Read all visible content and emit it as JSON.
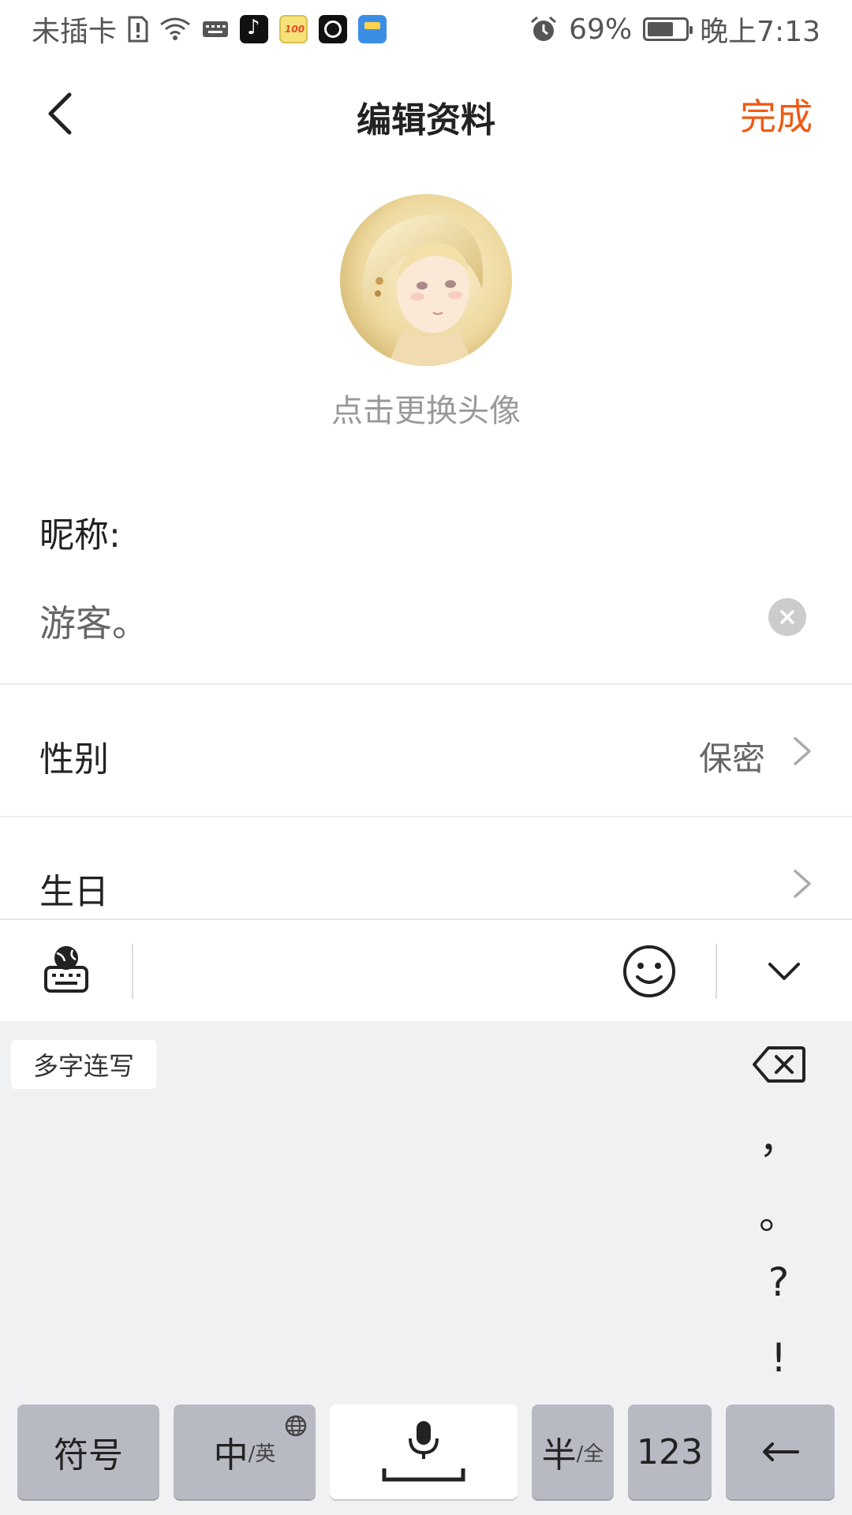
{
  "status_bar": {
    "carrier": "未插卡",
    "battery": "69%",
    "battery_level": 0.69,
    "time": "晚上7:13",
    "icons": [
      "sim-alert-icon",
      "wifi-icon",
      "keyboard-icon",
      "tiktok-icon",
      "score-100-icon",
      "record-icon",
      "message-icon",
      "alarm-icon",
      "battery-icon"
    ]
  },
  "header": {
    "title": "编辑资料",
    "done_label": "完成",
    "back_icon": "chevron-left-icon",
    "accent_color": "#f05a14"
  },
  "avatar": {
    "hint": "点击更换头像"
  },
  "form": {
    "nickname_label": "昵称:",
    "nickname_value": "游客。",
    "gender_label": "性别",
    "gender_value": "保密",
    "birthday_label": "生日"
  },
  "keyboard": {
    "toolbar_icons": [
      "globe-keyboard-icon",
      "emoji-icon",
      "chevron-down-icon"
    ],
    "multi_char_label": "多字连写",
    "punctuation": [
      "，",
      "。",
      "?",
      "!"
    ],
    "keys": {
      "symbol": "符号",
      "lang_main": "中",
      "lang_sub": "/英",
      "half_main": "半",
      "half_sub": "/全",
      "num": "123"
    }
  }
}
